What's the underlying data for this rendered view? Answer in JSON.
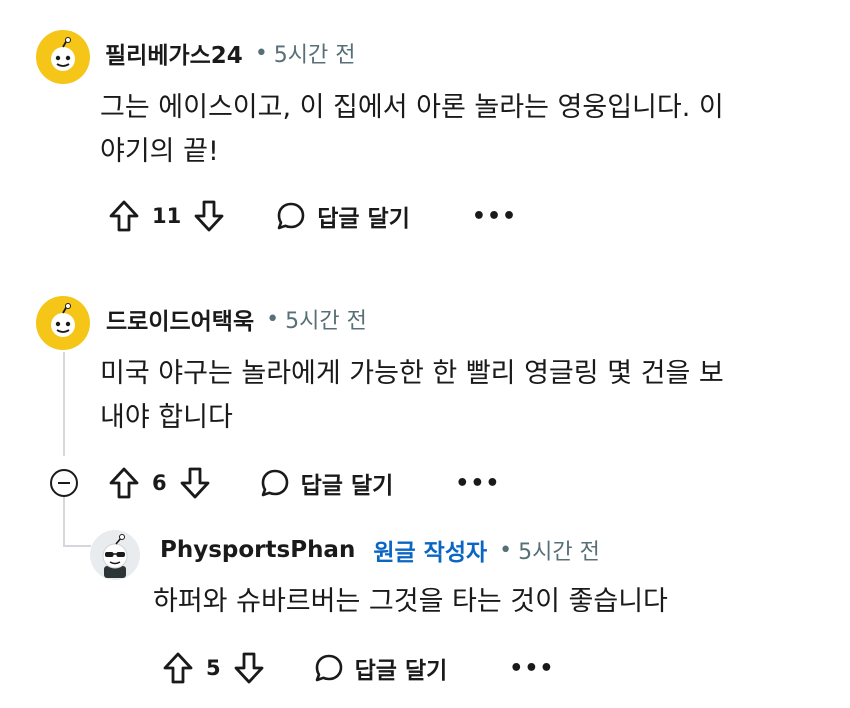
{
  "comments": [
    {
      "username": "필리베가스24",
      "separator": "•",
      "time": "5시간 전",
      "body_lines": [
        "그는 에이스이고, 이 집에서 아론 놀라는 영웅입니다. 이",
        "야기의 끝!"
      ],
      "score": "11",
      "reply_label": "답글 달기",
      "more": "•••",
      "avatar_icon": "snoo-avatar-icon",
      "avatar_color": "#f5c518"
    },
    {
      "username": "드로이드어택욱",
      "separator": "•",
      "time": "5시간 전",
      "body_lines": [
        "미국 야구는 놀라에게 가능한 한 빨리 영글링 몇 건을 보",
        "내야 합니다"
      ],
      "score": "6",
      "reply_label": "답글 달기",
      "more": "•••",
      "avatar_icon": "snoo-avatar-icon",
      "avatar_color": "#f5c518"
    },
    {
      "username": "PhysportsPhan",
      "op_label": "원글 작성자",
      "separator": "•",
      "time": "5시간 전",
      "body_lines": [
        "하퍼와 슈바르버는 그것을 타는 것이 좋습니다"
      ],
      "score": "5",
      "reply_label": "답글 달기",
      "more": "•••",
      "avatar_icon": "sunglasses-snoo-avatar-icon",
      "avatar_color": "#e9ecef"
    }
  ],
  "colors": {
    "op_badge": "#0a66c2",
    "meta": "#576f76",
    "thread_line": "#d4d8dc"
  }
}
